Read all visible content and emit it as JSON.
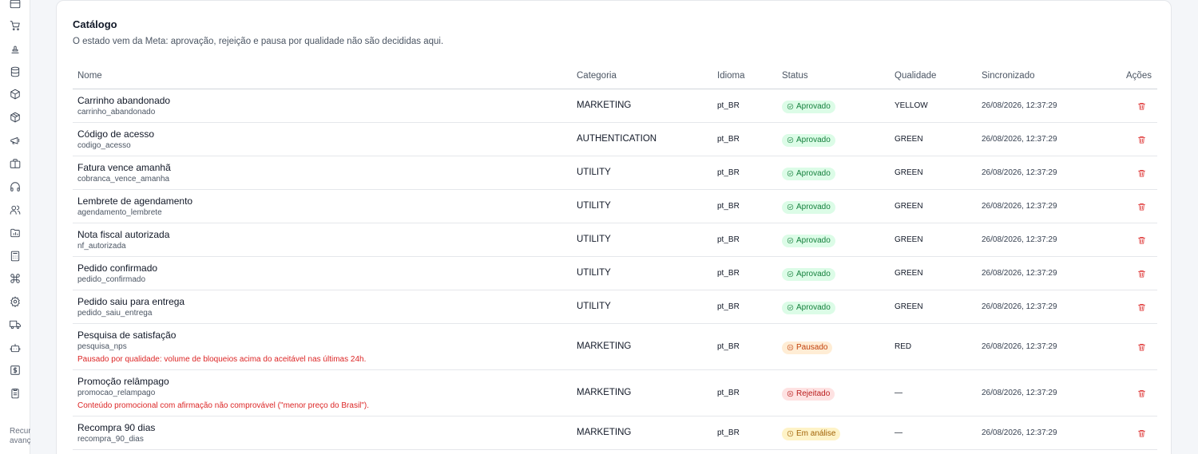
{
  "sidebar": {
    "icons": [
      "credit-card-icon",
      "cart-icon",
      "stamp-icon",
      "database-icon",
      "box-icon",
      "package-icon",
      "megaphone-icon",
      "briefcase-icon",
      "headphones-icon",
      "users-icon",
      "folder-chart-icon",
      "calculator-icon",
      "command-icon",
      "gear-icon",
      "truck-icon",
      "bot-icon",
      "dollar-icon",
      "clipboard-icon"
    ],
    "footer_text_line1": "Recur",
    "footer_text_line2": "avanç"
  },
  "catalog": {
    "title": "Catálogo",
    "subtitle": "O estado vem da Meta: aprovação, rejeição e pausa por qualidade não são decididas aqui."
  },
  "table": {
    "headers": {
      "name": "Nome",
      "category": "Categoria",
      "language": "Idioma",
      "status": "Status",
      "quality": "Qualidade",
      "synced": "Sincronizado",
      "actions": "Ações"
    },
    "rows": [
      {
        "name": "Carrinho abandonado",
        "code": "carrinho_abandonado",
        "category": "MARKETING",
        "language": "pt_BR",
        "status": "Aprovado",
        "status_kind": "aprovado",
        "quality": "YELLOW",
        "synced": "26/08/2026, 12:37:29"
      },
      {
        "name": "Código de acesso",
        "code": "codigo_acesso",
        "category": "AUTHENTICATION",
        "language": "pt_BR",
        "status": "Aprovado",
        "status_kind": "aprovado",
        "quality": "GREEN",
        "synced": "26/08/2026, 12:37:29"
      },
      {
        "name": "Fatura vence amanhã",
        "code": "cobranca_vence_amanha",
        "category": "UTILITY",
        "language": "pt_BR",
        "status": "Aprovado",
        "status_kind": "aprovado",
        "quality": "GREEN",
        "synced": "26/08/2026, 12:37:29"
      },
      {
        "name": "Lembrete de agendamento",
        "code": "agendamento_lembrete",
        "category": "UTILITY",
        "language": "pt_BR",
        "status": "Aprovado",
        "status_kind": "aprovado",
        "quality": "GREEN",
        "synced": "26/08/2026, 12:37:29"
      },
      {
        "name": "Nota fiscal autorizada",
        "code": "nf_autorizada",
        "category": "UTILITY",
        "language": "pt_BR",
        "status": "Aprovado",
        "status_kind": "aprovado",
        "quality": "GREEN",
        "synced": "26/08/2026, 12:37:29"
      },
      {
        "name": "Pedido confirmado",
        "code": "pedido_confirmado",
        "category": "UTILITY",
        "language": "pt_BR",
        "status": "Aprovado",
        "status_kind": "aprovado",
        "quality": "GREEN",
        "synced": "26/08/2026, 12:37:29"
      },
      {
        "name": "Pedido saiu para entrega",
        "code": "pedido_saiu_entrega",
        "category": "UTILITY",
        "language": "pt_BR",
        "status": "Aprovado",
        "status_kind": "aprovado",
        "quality": "GREEN",
        "synced": "26/08/2026, 12:37:29"
      },
      {
        "name": "Pesquisa de satisfação",
        "code": "pesquisa_nps",
        "note": "Pausado por qualidade: volume de bloqueios acima do aceitável nas últimas 24h.",
        "category": "MARKETING",
        "language": "pt_BR",
        "status": "Pausado",
        "status_kind": "pausado",
        "quality": "RED",
        "synced": "26/08/2026, 12:37:29"
      },
      {
        "name": "Promoção relâmpago",
        "code": "promocao_relampago",
        "note": "Conteúdo promocional com afirmação não comprovável (\"menor preço do Brasil\").",
        "category": "MARKETING",
        "language": "pt_BR",
        "status": "Rejeitado",
        "status_kind": "rejeitado",
        "quality": "—",
        "synced": "26/08/2026, 12:37:29"
      },
      {
        "name": "Recompra 90 dias",
        "code": "recompra_90_dias",
        "category": "MARKETING",
        "language": "pt_BR",
        "status": "Em análise",
        "status_kind": "analise",
        "quality": "—",
        "synced": "26/08/2026, 12:37:29"
      }
    ]
  }
}
